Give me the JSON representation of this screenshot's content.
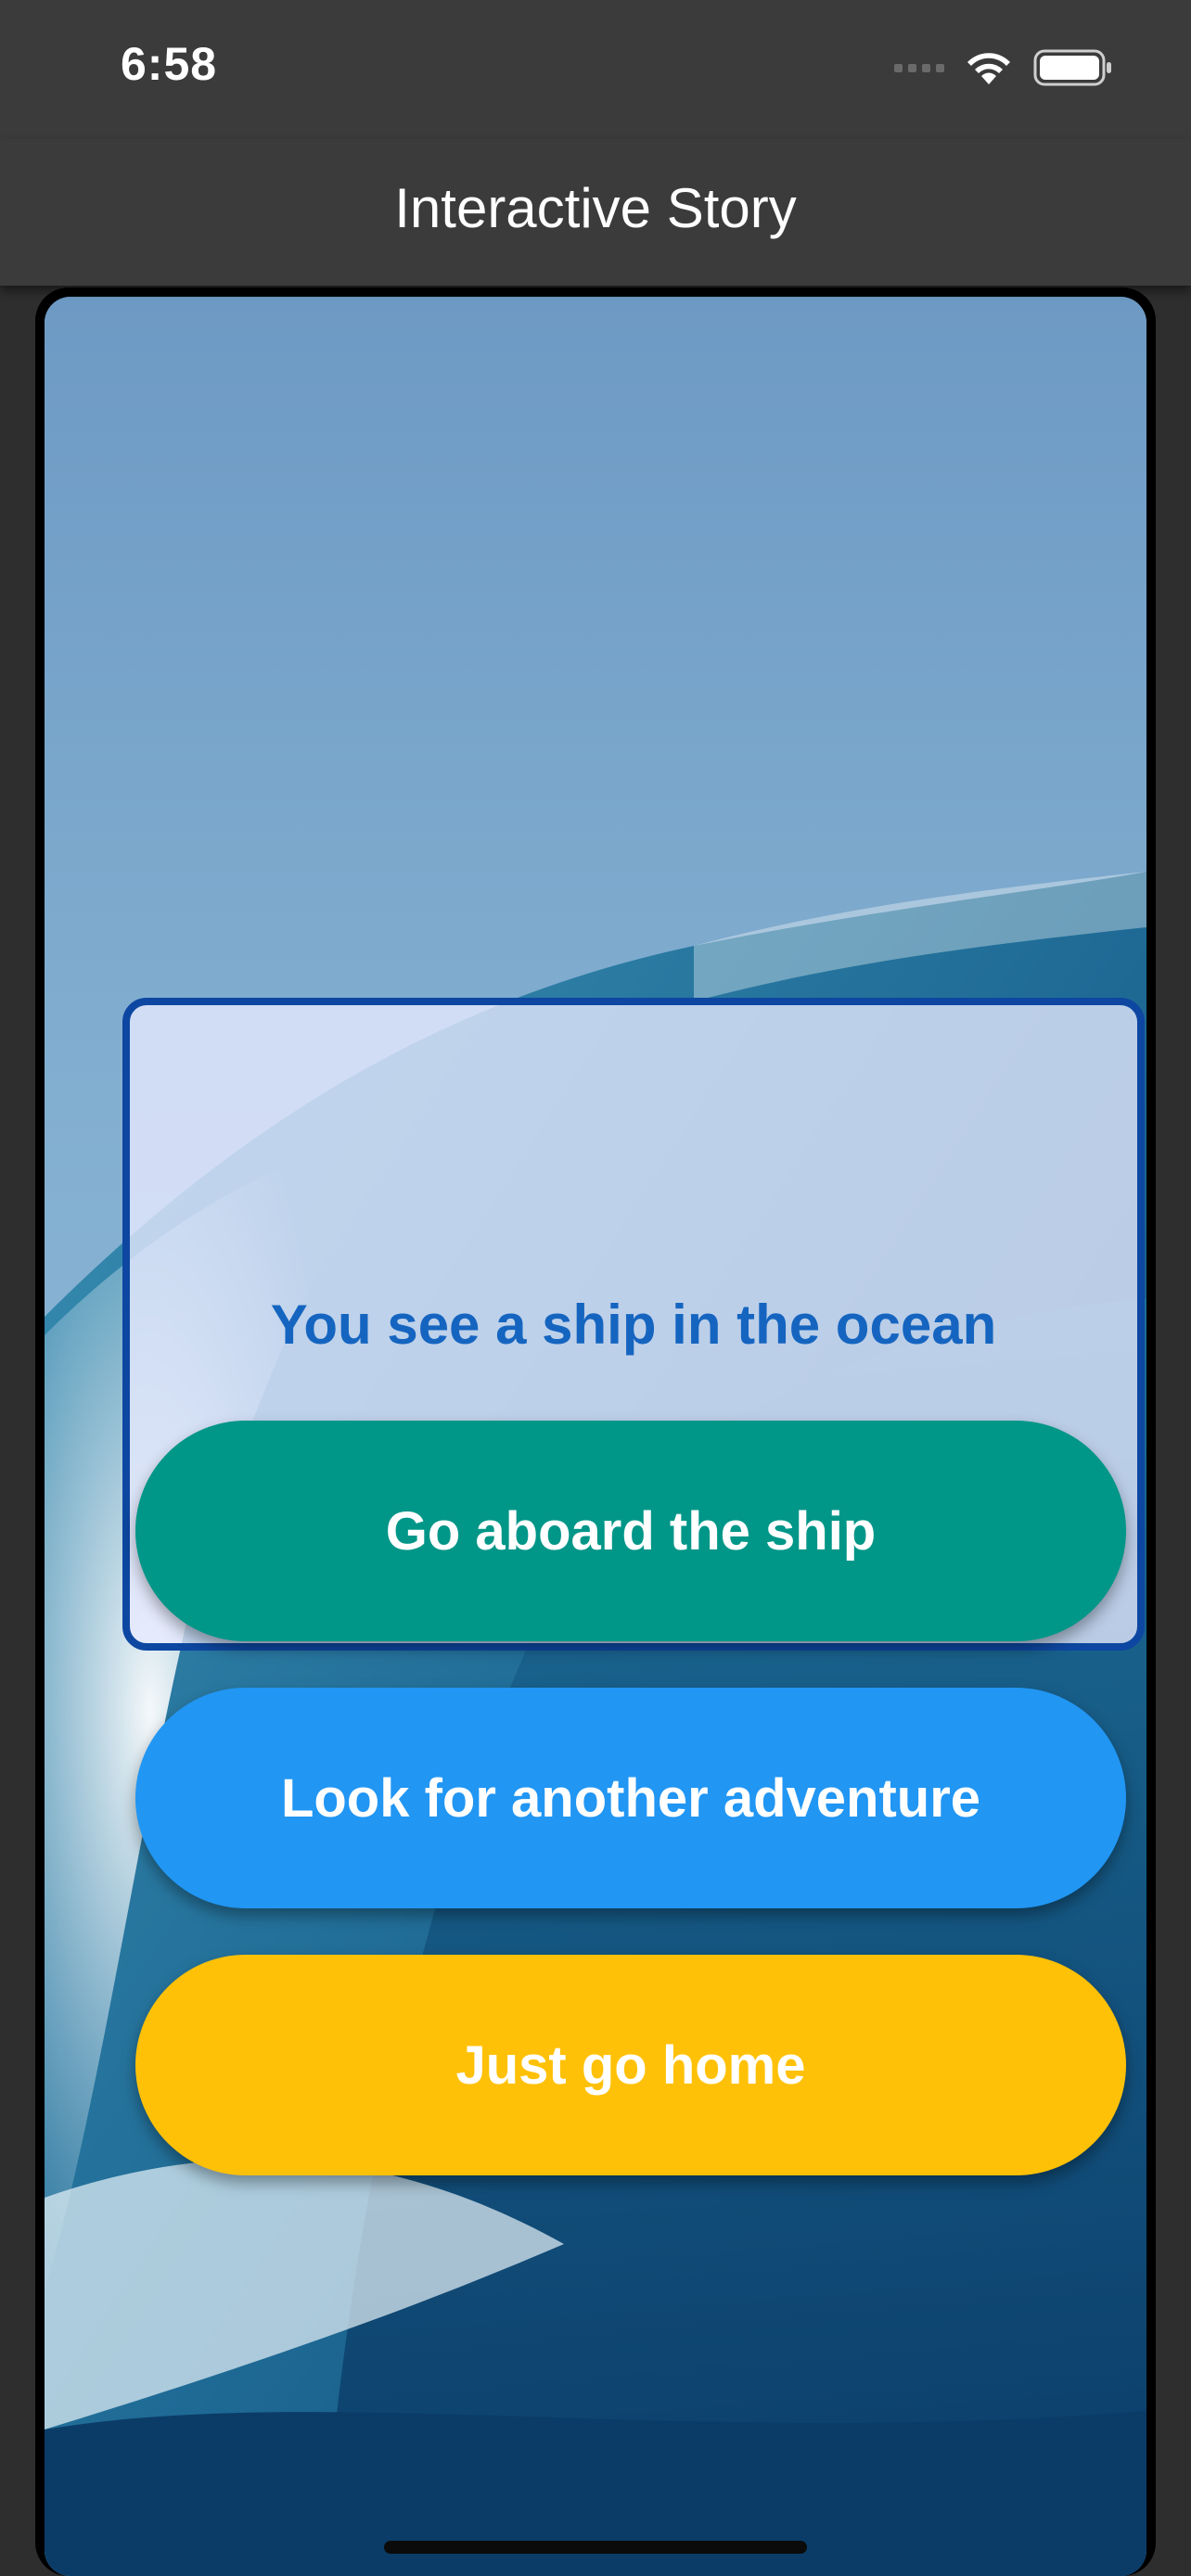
{
  "status_bar": {
    "time": "6:58"
  },
  "app_bar": {
    "title": "Interactive Story"
  },
  "story": {
    "text": "You see a ship in the ocean"
  },
  "choices": [
    {
      "label": "Go aboard the ship",
      "color": "#009688"
    },
    {
      "label": "Look for another adventure",
      "color": "#2196f3"
    },
    {
      "label": "Just go home",
      "color": "#ffc107"
    }
  ],
  "colors": {
    "app_bar": "#3b3b3b",
    "story_border": "#0d47a1",
    "story_text": "#1565c0",
    "background_image": "ocean-wave"
  }
}
